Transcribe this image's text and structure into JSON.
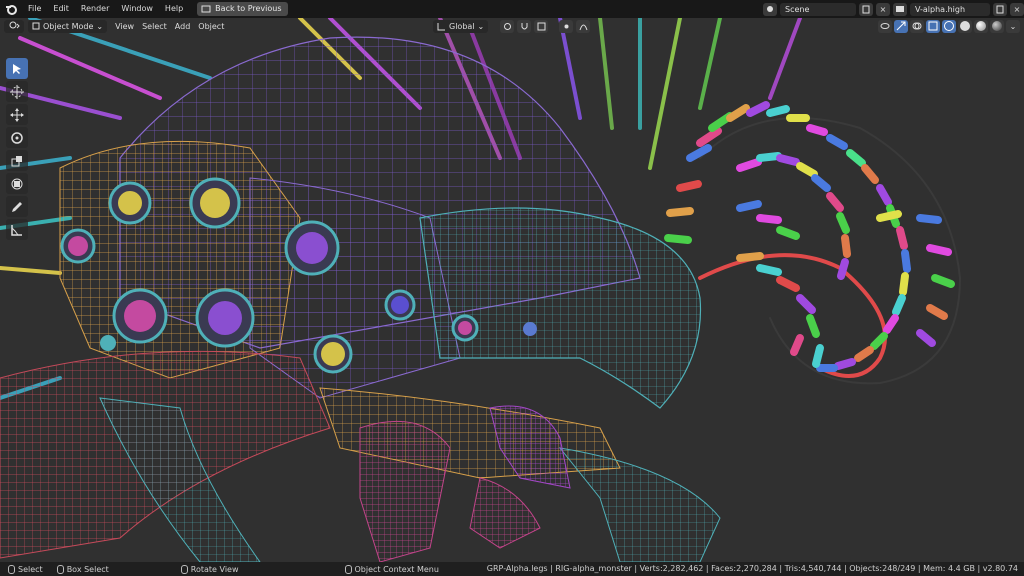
{
  "topbar": {
    "menus": [
      "File",
      "Edit",
      "Render",
      "Window",
      "Help"
    ],
    "back_button": "Back to Previous",
    "scene": "Scene",
    "view_layer": "V-alpha.high"
  },
  "header": {
    "mode": "Object Mode",
    "menus": [
      "View",
      "Select",
      "Add",
      "Object"
    ],
    "orientation": "Global"
  },
  "tools": [
    "select-box",
    "cursor",
    "move",
    "rotate",
    "scale",
    "transform",
    "annotate",
    "measure"
  ],
  "statusbar": {
    "select": "Select",
    "box_select": "Box Select",
    "rotate_view": "Rotate View",
    "context_menu": "Object Context Menu",
    "stats": "GRP-Alpha.legs | RIG-alpha_monster | Verts:2,282,462 | Faces:2,270,284 | Tris:4,540,744 | Objects:248/249 | Mem: 4.4 GB | v2.80.74"
  },
  "colors": {
    "accent": "#4772b3",
    "bg": "#303030",
    "topbar": "#181818"
  }
}
